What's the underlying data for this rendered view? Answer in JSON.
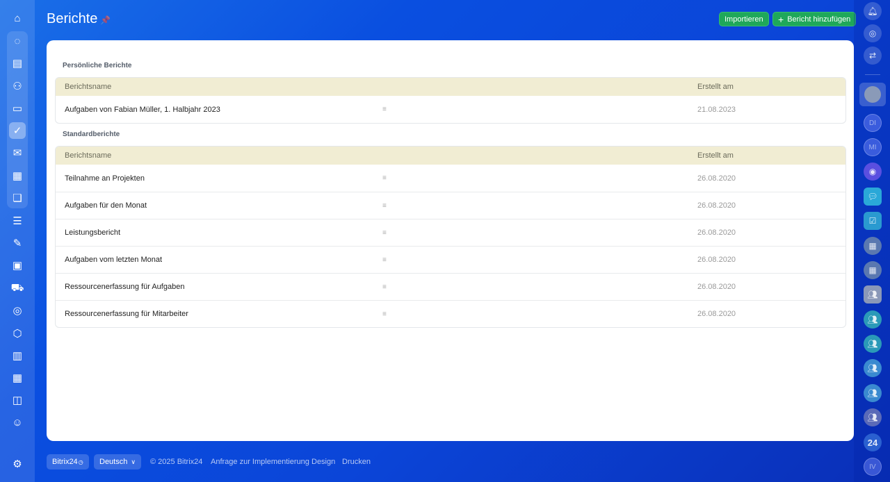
{
  "header": {
    "title": "Berichte",
    "import_label": "Importieren",
    "add_label": "Bericht hinzufügen"
  },
  "personal": {
    "heading": "Persönliche Berichte",
    "col_name": "Berichtsname",
    "col_date": "Erstellt am",
    "rows": [
      {
        "name": "Aufgaben von Fabian Müller, 1. Halbjahr 2023",
        "date": "21.08.2023"
      }
    ]
  },
  "standard": {
    "heading": "Standardberichte",
    "col_name": "Berichtsname",
    "col_date": "Erstellt am",
    "rows": [
      {
        "name": "Teilnahme an Projekten",
        "date": "26.08.2020"
      },
      {
        "name": "Aufgaben für den Monat",
        "date": "26.08.2020"
      },
      {
        "name": "Leistungsbericht",
        "date": "26.08.2020"
      },
      {
        "name": "Aufgaben vom letzten Monat",
        "date": "26.08.2020"
      },
      {
        "name": "Ressourcenerfassung für Aufgaben",
        "date": "26.08.2020"
      },
      {
        "name": "Ressourcenerfassung für Mitarbeiter",
        "date": "26.08.2020"
      }
    ]
  },
  "row_menu_glyph": "≡",
  "footer": {
    "brand": "Bitrix24",
    "language": "Deutsch",
    "copyright": "© 2025 Bitrix24",
    "links": [
      "Anfrage zur Implementierung",
      "Design",
      "Drucken"
    ]
  },
  "right_sidebar": {
    "avatars": [
      "DI",
      "MI"
    ],
    "counter": "24",
    "last": "IV"
  }
}
